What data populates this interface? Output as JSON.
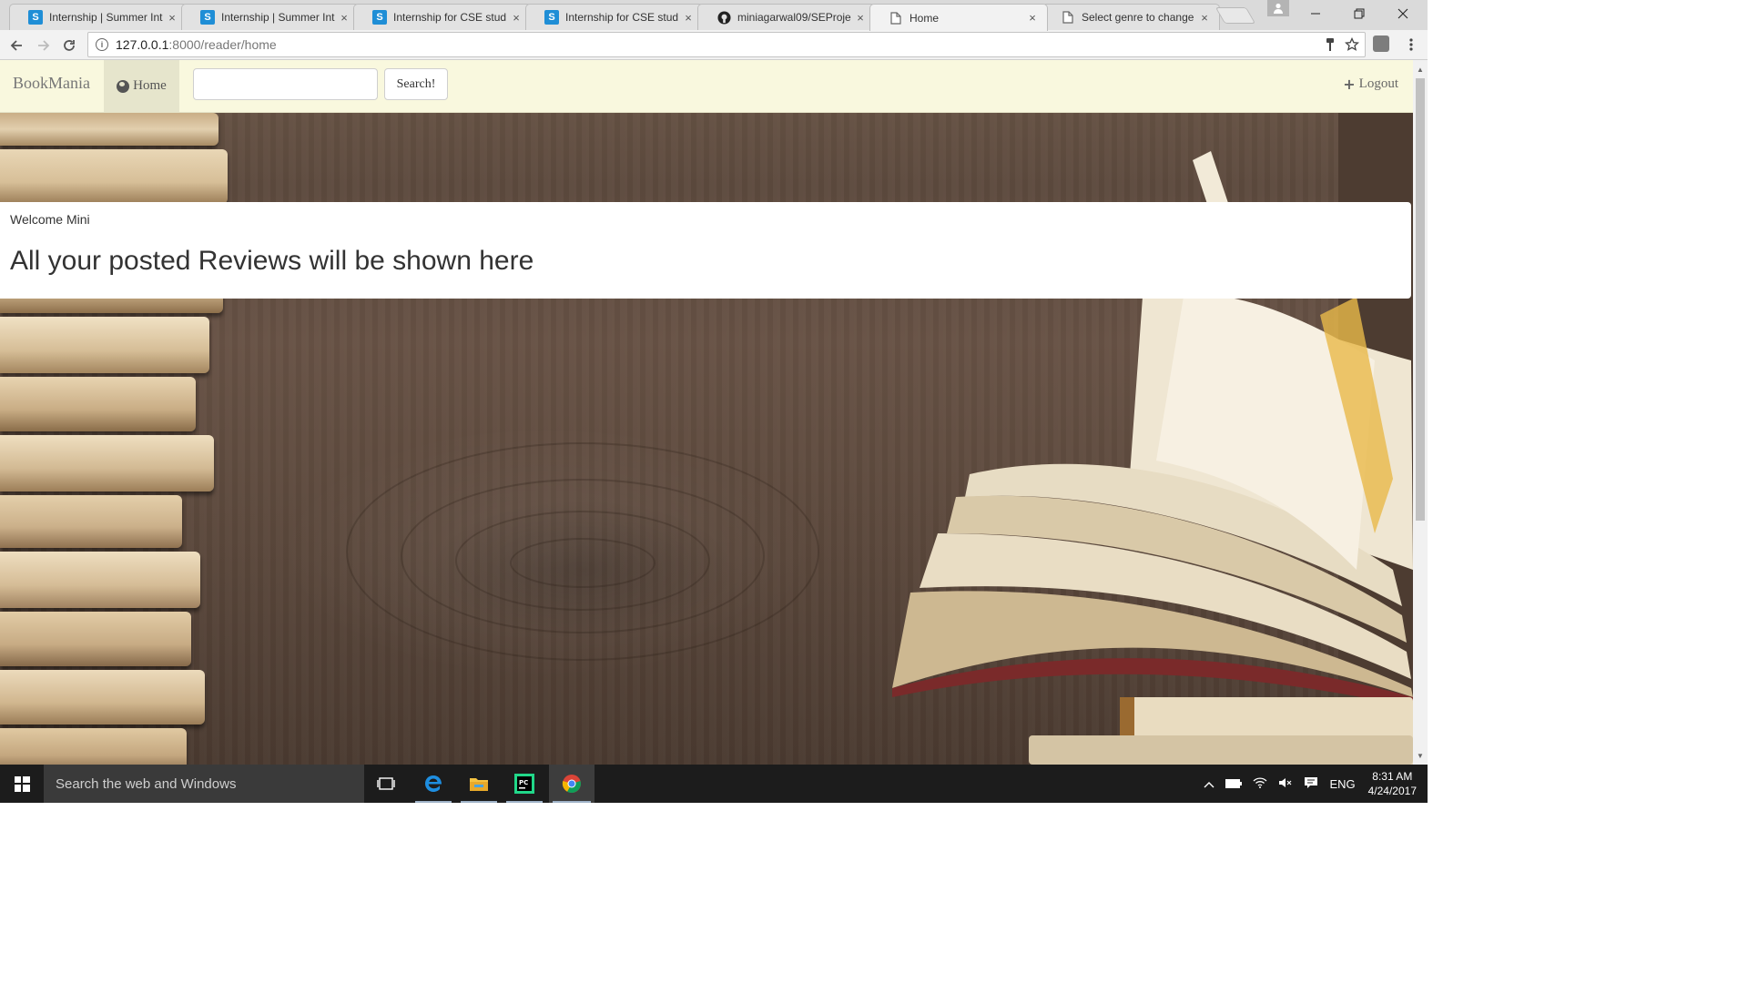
{
  "browser": {
    "tabs": [
      {
        "title": "Internship | Summer Int",
        "favicon": "internshala-icon",
        "active": false
      },
      {
        "title": "Internship | Summer Int",
        "favicon": "internshala-icon",
        "active": false
      },
      {
        "title": "Internship for CSE stud",
        "favicon": "internshala-icon",
        "active": false
      },
      {
        "title": "Internship for CSE stud",
        "favicon": "internshala-icon",
        "active": false
      },
      {
        "title": "miniagarwal09/SEProje",
        "favicon": "github-icon",
        "active": false
      },
      {
        "title": "Home",
        "favicon": "page-icon",
        "active": true
      },
      {
        "title": "Select genre to change",
        "favicon": "page-icon",
        "active": false
      }
    ],
    "close_glyph": "×",
    "url_host": "127.0.0.1",
    "url_path": ":8000/reader/home"
  },
  "navbar": {
    "brand": "BookMania",
    "home_label": "Home",
    "search_value": "",
    "search_button": "Search!",
    "logout_label": "Logout"
  },
  "main": {
    "welcome_text": "Welcome Mini",
    "reviews_heading": "All your posted Reviews will be shown here"
  },
  "taskbar": {
    "search_placeholder": "Search the web and Windows",
    "language": "ENG",
    "time": "8:31 AM",
    "date": "4/24/2017"
  },
  "colors": {
    "navbar_bg": "#f9f8de",
    "navbar_active_bg": "#e6e5cc",
    "wood": "#5d4a3e",
    "taskbar": "#1c1c1c"
  }
}
